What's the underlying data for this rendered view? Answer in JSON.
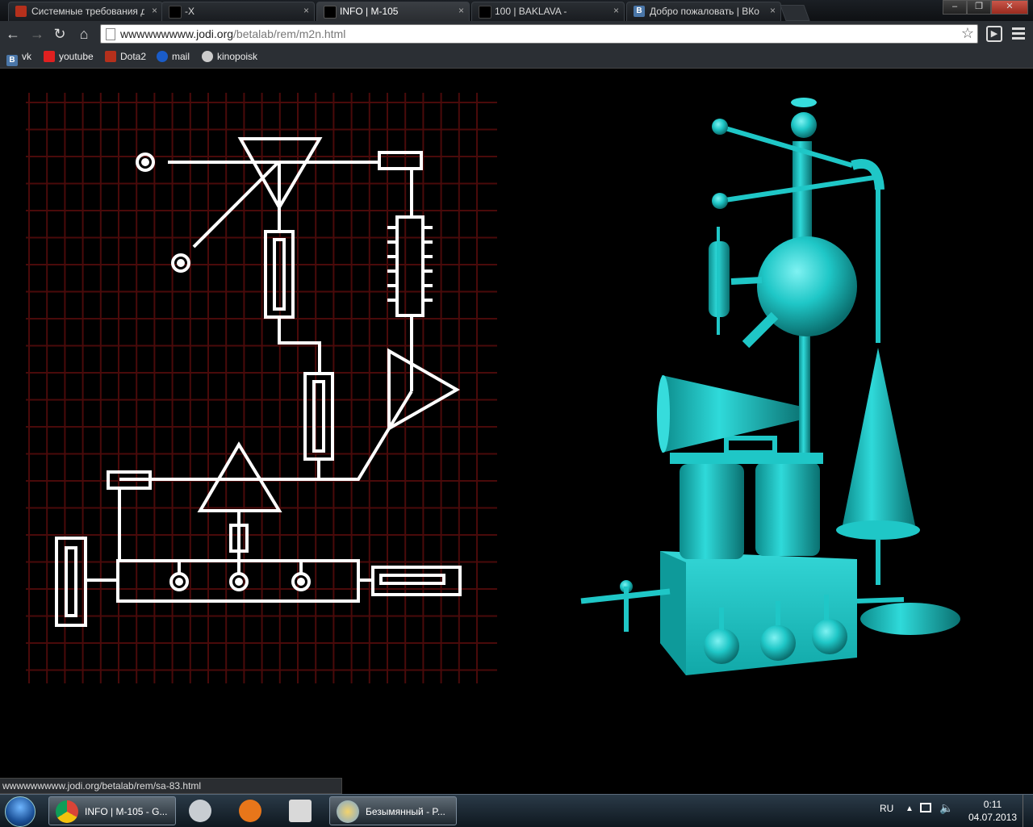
{
  "browser": {
    "tabs": [
      {
        "title": "Системные требования д",
        "icon": "dota-icon",
        "active": false
      },
      {
        "title": "-X",
        "icon": "black-square-icon",
        "active": false
      },
      {
        "title": "INFO | M-105",
        "icon": "black-square-icon",
        "active": true
      },
      {
        "title": "100 | BAKLAVA -",
        "icon": "black-square-icon",
        "active": false
      },
      {
        "title": "Добро пожаловать | ВКо",
        "icon": "vk-icon",
        "active": false
      }
    ],
    "close_glyph": "×",
    "window_buttons": {
      "minimize": "–",
      "restore": "❐",
      "close": "✕"
    },
    "url_host": "wwwwwwwww.jodi.org",
    "url_path": "/betalab/rem/m2n.html",
    "bookmarks": [
      {
        "label": "vk",
        "icon": "vk-icon",
        "color": "#4a76a8"
      },
      {
        "label": "youtube",
        "icon": "youtube-icon",
        "color": "#e02020"
      },
      {
        "label": "Dota2",
        "icon": "dota-icon",
        "color": "#b5301c"
      },
      {
        "label": "mail",
        "icon": "mail-icon",
        "color": "#1a5cc8"
      },
      {
        "label": "kinopoisk",
        "icon": "kinopoisk-icon",
        "color": "#cccccc"
      }
    ],
    "status_url": "wwwwwwwww.jodi.org/betalab/rem/sa-83.html"
  },
  "taskbar": {
    "items": [
      {
        "label": "INFO | M-105 - G...",
        "icon": "chrome-icon"
      },
      {
        "label": "",
        "icon": "steam-icon"
      },
      {
        "label": "",
        "icon": "lightning-icon"
      },
      {
        "label": "",
        "icon": "media-classic-icon"
      },
      {
        "label": "Безымянный - P...",
        "icon": "paint-icon"
      }
    ],
    "lang": "RU",
    "time": "0:11",
    "date": "04.07.2013"
  },
  "colors": {
    "grid": "#4a0a0a",
    "circuit": "#ffffff",
    "machine": "#1fc7c7"
  }
}
